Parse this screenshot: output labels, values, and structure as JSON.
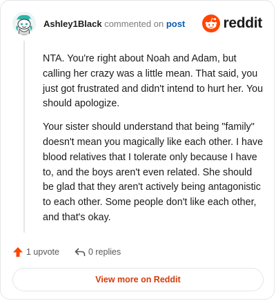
{
  "header": {
    "username": "Ashley1Black",
    "action_text": "commented on",
    "post_link": "post",
    "brand": "reddit",
    "avatar_icon": "snoo-avatar-icon",
    "brand_icon": "reddit-snoo-icon"
  },
  "comment": {
    "paragraphs": [
      "NTA. You're right about Noah and Adam, but calling her crazy was a little mean. That said, you just got frustrated and didn't intend to hurt her. You should apologize.",
      "Your sister should understand that being \"family\" doesn't mean you magically like each other. I have blood relatives that I tolerate only because I have to, and the boys aren't even related. She should be glad that they aren't actively being antagonistic to each other. Some people don't like each other, and that's okay."
    ]
  },
  "actions": {
    "upvote_label": "1 upvote",
    "upvote_icon": "upvote-arrow-icon",
    "reply_label": "0 replies",
    "reply_icon": "reply-arrow-icon"
  },
  "footer": {
    "view_more_label": "View more on Reddit"
  },
  "colors": {
    "brand_orange": "#ff4500",
    "upvote_orange": "#ff4500",
    "link_blue": "#0b5cad",
    "button_text": "#d23b0c"
  }
}
